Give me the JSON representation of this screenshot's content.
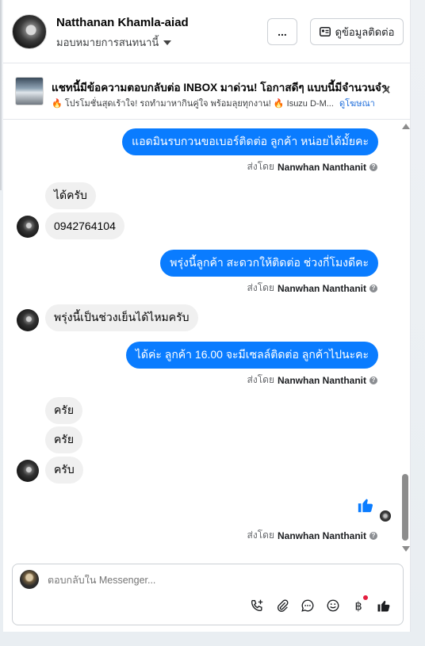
{
  "header": {
    "contact_name": "Natthanan Khamla-aiad",
    "assign_label": "มอบหมายการสนทนานี้",
    "more_label": "...",
    "contact_info_label": "ดูข้อมูลติดต่อ"
  },
  "ad": {
    "title": "แชทนี้มีข้อความตอบกลับต่อ INBOX มาด่วน! โอกาสดีๆ แบบนี้มีจำนวนจำกัด!",
    "subtitle": "🔥 โปรโมชั่นสุดเร้าใจ! รถทำมาหากินคู่ใจ พร้อมลุยทุกงาน! 🔥 Isuzu D-M...",
    "link": "ดูโฆษณา"
  },
  "messages": [
    {
      "dir": "out",
      "text": "แอดมินรบกวนขอเบอร์ติดต่อ ลูกค้า หน่อยได้มั้ยคะ"
    },
    {
      "dir": "in",
      "text": "ได้ครับ"
    },
    {
      "dir": "in",
      "text": "0942764104"
    },
    {
      "dir": "out",
      "text": "พรุ่งนี้ลูกค้า สะดวกให้ติดต่อ ช่วงกี่โมงดีคะ"
    },
    {
      "dir": "in",
      "text": "พรุ่งนี้เป็นช่วงเย็นได้ไหมครับ"
    },
    {
      "dir": "out",
      "text": "ได้ค่ะ  ลูกค้า 16.00 จะมีเซลล์ติดต่อ ลูกค้าไปนะคะ"
    },
    {
      "dir": "in",
      "text": "ครัย"
    },
    {
      "dir": "in",
      "text": "ครัย"
    },
    {
      "dir": "in",
      "text": "ครับ"
    }
  ],
  "sent_by": {
    "prefix": "ส่งโดย",
    "name": "Nanwhan Nanthanit"
  },
  "composer": {
    "placeholder": "ตอบกลับใน Messenger..."
  },
  "colors": {
    "outgoing_bubble": "#0a7cff",
    "incoming_bubble": "#f0f0f0",
    "link": "#216fdb"
  },
  "icons": [
    "more-icon",
    "contact-card-icon",
    "close-icon",
    "info-icon",
    "like-icon",
    "call-add-icon",
    "attach-icon",
    "saved-reply-icon",
    "emoji-icon",
    "baht-icon",
    "thumbs-up-icon"
  ]
}
